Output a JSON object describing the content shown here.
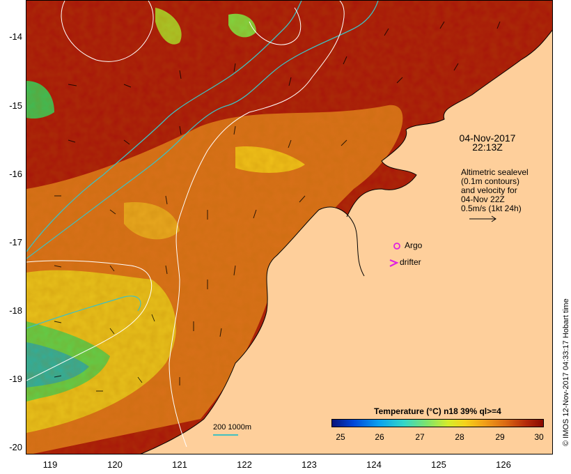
{
  "map": {
    "lat_ticks": [
      "-14",
      "-15",
      "-16",
      "-17",
      "-18",
      "-19",
      "-20"
    ],
    "lon_ticks": [
      "119",
      "120",
      "121",
      "122",
      "123",
      "124",
      "125",
      "126"
    ],
    "date": "04-Nov-2017",
    "time": "22:13Z",
    "annotation_lines": [
      "Altimetric sealevel",
      "(0.1m contours)",
      "and velocity for",
      "04-Nov 22Z",
      "0.5m/s (1kt 24h)"
    ],
    "legend_argo": "Argo",
    "legend_drifter": "drifter",
    "bathy_label": "200  1000m",
    "colors": {
      "land": "#fecf9b",
      "argo": "#e020e0",
      "drifter": "#e020e0",
      "isobath": "#40c0c0",
      "contour": "#ffffff"
    }
  },
  "colorbar": {
    "title": "Temperature (°C) n18 39% ql>=4",
    "ticks": [
      "25",
      "26",
      "27",
      "28",
      "29",
      "30"
    ]
  },
  "credit": "© IMOS 12-Nov-2017 04:33:17 Hobart time"
}
